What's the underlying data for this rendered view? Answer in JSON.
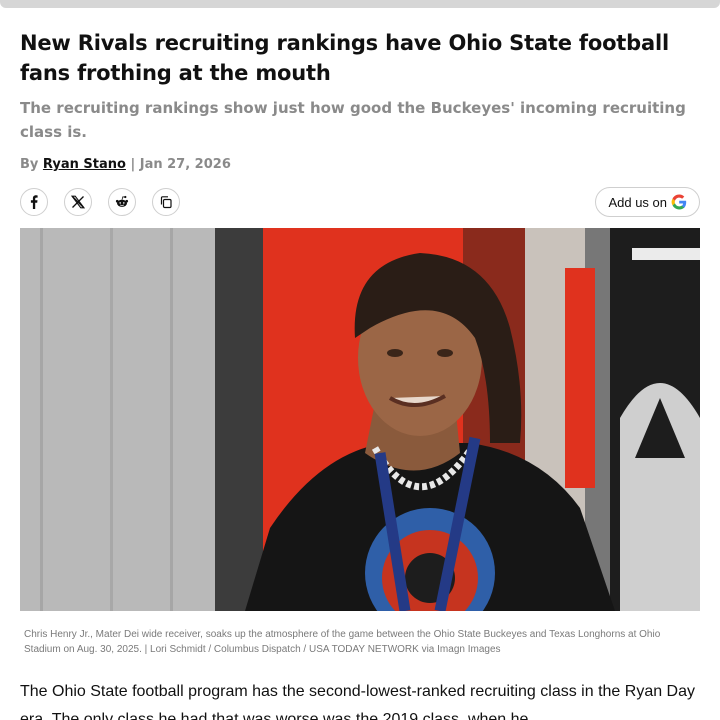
{
  "article": {
    "headline": "New Rivals recruiting rankings have Ohio State football fans frothing at the mouth",
    "subheadline": "The recruiting rankings show just how good the Buckeyes' incoming recruiting class is.",
    "byline": {
      "prefix": "By",
      "author": "Ryan Stano",
      "separator": "|",
      "date": "Jan 27, 2026"
    },
    "share": {
      "icons": [
        "facebook-icon",
        "x-icon",
        "reddit-icon",
        "copy-link-icon"
      ]
    },
    "add_us": {
      "label": "Add us on",
      "icon": "google-icon"
    },
    "photo": {
      "colors": {
        "wall": "#b9b9b9",
        "red": "#e0321e",
        "shirt": "#151515"
      }
    },
    "caption": "Chris Henry Jr., Mater Dei wide receiver, soaks up the atmosphere of the game between the Ohio State Buckeyes and Texas Longhorns at Ohio Stadium on Aug. 30, 2025. | Lori Schmidt / Columbus Dispatch / USA TODAY NETWORK via Imagn Images",
    "body_text": "The Ohio State football program has the second-lowest-ranked recruiting class in the Ryan Day era. The only class he had that was worse was the 2019 class, when he"
  }
}
